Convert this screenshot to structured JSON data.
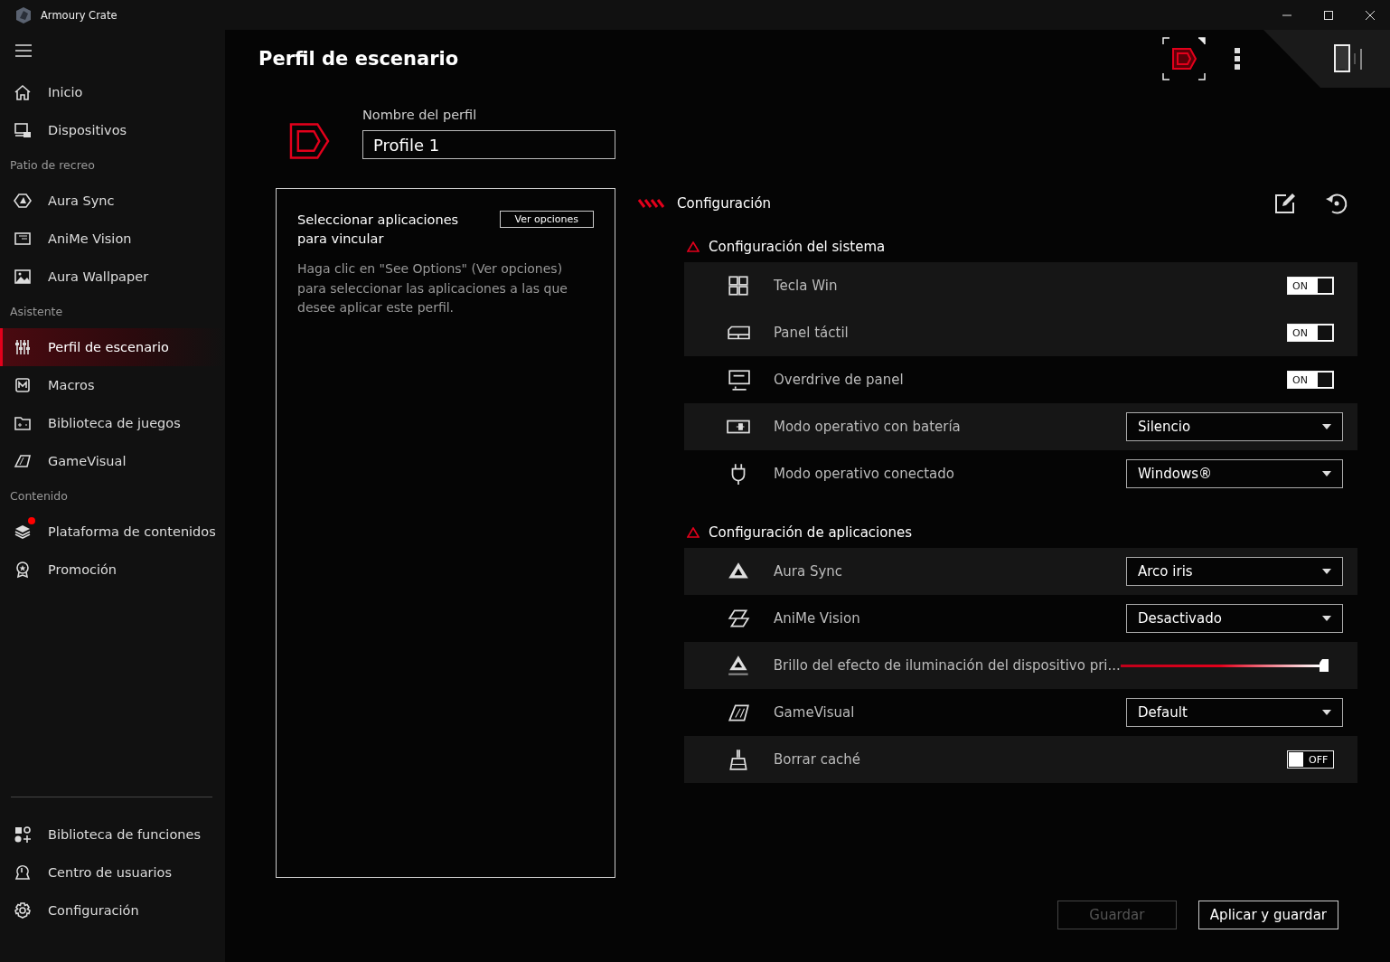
{
  "window": {
    "title": "Armoury Crate"
  },
  "sidebar": {
    "groups": [
      {
        "items": [
          {
            "label": "Inicio",
            "selected": false,
            "badge": false
          },
          {
            "label": "Dispositivos",
            "selected": false,
            "badge": false
          }
        ]
      },
      {
        "heading": "Patio de recreo",
        "items": [
          {
            "label": "Aura Sync",
            "selected": false,
            "badge": false
          },
          {
            "label": "AniMe Vision",
            "selected": false,
            "badge": false
          },
          {
            "label": "Aura Wallpaper",
            "selected": false,
            "badge": false
          }
        ]
      },
      {
        "heading": "Asistente",
        "items": [
          {
            "label": "Perfil de escenario",
            "selected": true,
            "badge": false
          },
          {
            "label": "Macros",
            "selected": false,
            "badge": false
          },
          {
            "label": "Biblioteca de juegos",
            "selected": false,
            "badge": false
          },
          {
            "label": "GameVisual",
            "selected": false,
            "badge": false
          }
        ]
      },
      {
        "heading": "Contenido",
        "items": [
          {
            "label": "Plataforma de contenidos",
            "selected": false,
            "badge": true
          },
          {
            "label": "Promoción",
            "selected": false,
            "badge": false
          }
        ]
      }
    ],
    "bottom_items": [
      {
        "label": "Biblioteca de funciones",
        "selected": false
      },
      {
        "label": "Centro de usuarios",
        "selected": false
      },
      {
        "label": "Configuración",
        "selected": false
      }
    ]
  },
  "page": {
    "title": "Perfil de escenario"
  },
  "profile": {
    "name_label": "Nombre del perfil",
    "name_value": "Profile 1"
  },
  "apps_panel": {
    "title": "Seleccionar aplicaciones para vincular",
    "button": "Ver opciones",
    "description": "Haga clic en \"See Options\" (Ver opciones) para seleccionar las aplicaciones a las que desee aplicar este perfil."
  },
  "config": {
    "title": "Configuración",
    "sections": [
      {
        "title": "Configuración del sistema",
        "rows": [
          {
            "kind": "toggle",
            "label": "Tecla Win",
            "highlighted": true,
            "on": true,
            "state_text": "ON"
          },
          {
            "kind": "toggle",
            "label": "Panel táctil",
            "highlighted": true,
            "on": true,
            "state_text": "ON"
          },
          {
            "kind": "toggle",
            "label": "Overdrive de panel",
            "highlighted": false,
            "on": true,
            "state_text": "ON"
          },
          {
            "kind": "dropdown",
            "label": "Modo operativo con batería",
            "highlighted": true,
            "value": "Silencio"
          },
          {
            "kind": "dropdown",
            "label": "Modo operativo conectado",
            "highlighted": false,
            "value": "Windows®"
          }
        ]
      },
      {
        "title": "Configuración de aplicaciones",
        "rows": [
          {
            "kind": "dropdown",
            "label": "Aura Sync",
            "highlighted": true,
            "value": "Arco iris"
          },
          {
            "kind": "dropdown",
            "label": "AniMe Vision",
            "highlighted": false,
            "value": "Desactivado"
          },
          {
            "kind": "slider",
            "label": "Brillo del efecto de iluminación del dispositivo pri...",
            "highlighted": true,
            "level": 1
          },
          {
            "kind": "dropdown",
            "label": "GameVisual",
            "highlighted": false,
            "value": "Default"
          },
          {
            "kind": "toggle",
            "label": "Borrar caché",
            "highlighted": true,
            "on": false,
            "state_text": "OFF"
          }
        ]
      }
    ]
  },
  "actions": [
    {
      "label": "Guardar",
      "disabled": true
    },
    {
      "label": "Aplicar y guardar",
      "disabled": false
    }
  ]
}
